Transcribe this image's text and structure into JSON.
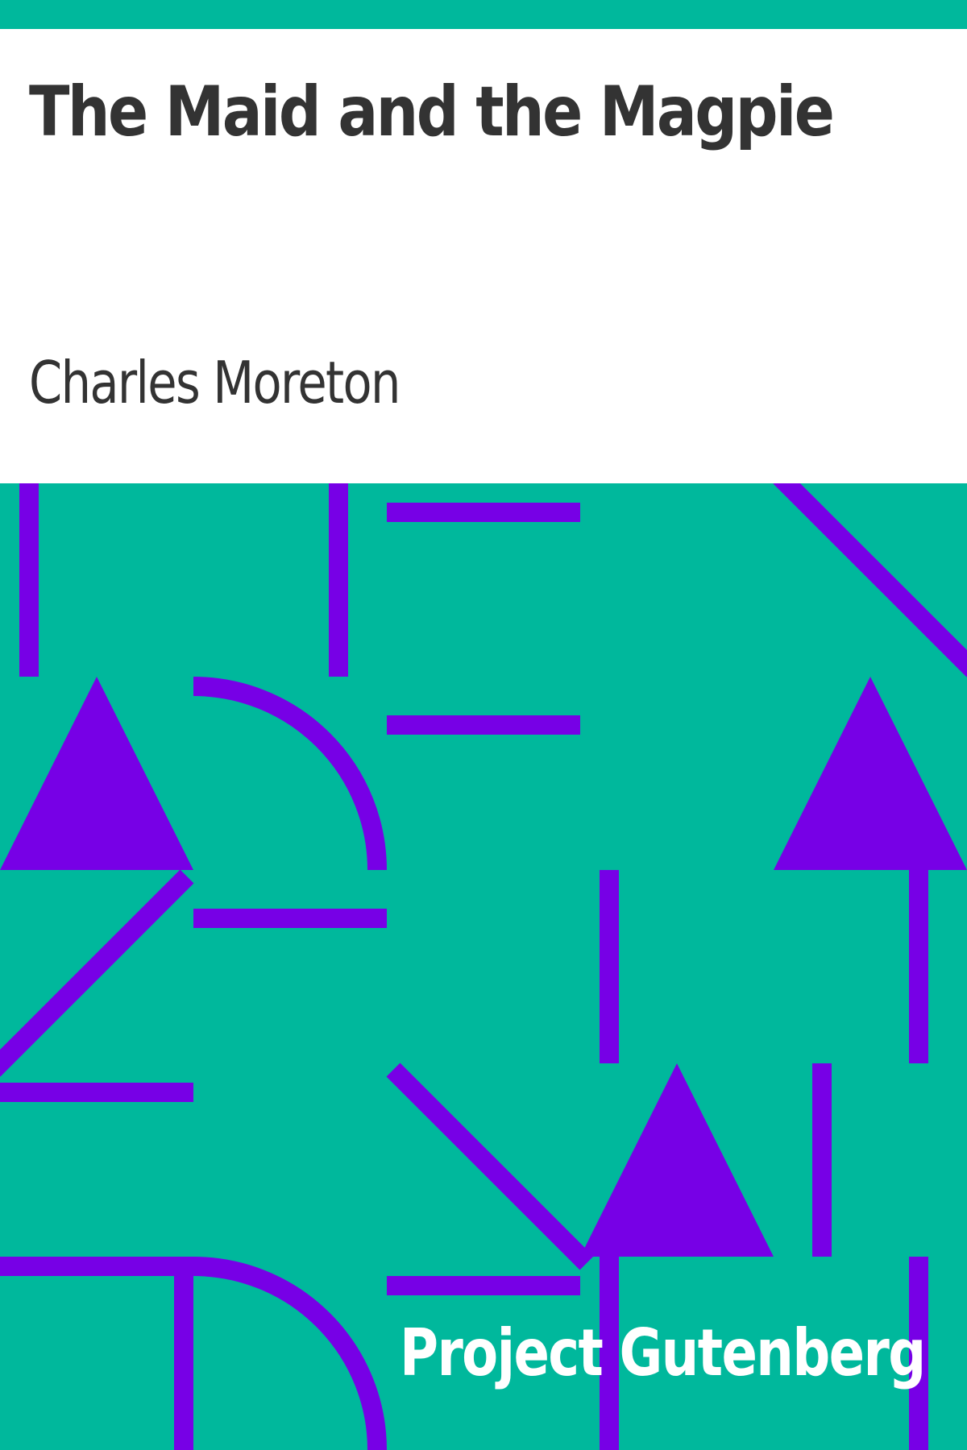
{
  "cover": {
    "title": "The Maid and the Magpie",
    "author": "Charles Moreton",
    "publisher": "Project Gutenberg",
    "colors": {
      "background": "#00b89c",
      "shapes": "#7700e6",
      "panel": "#ffffff",
      "text": "#333333",
      "publisher_text": "#ffffff"
    }
  }
}
